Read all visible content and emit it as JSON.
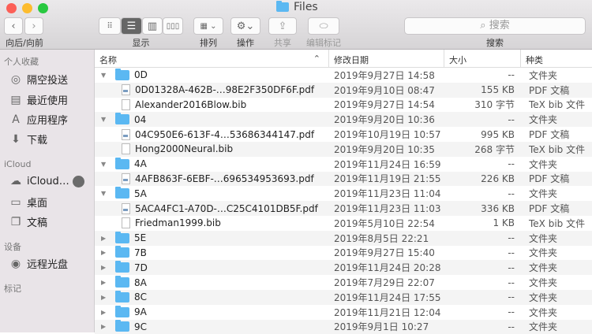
{
  "window": {
    "title": "Files"
  },
  "toolbar": {
    "nav_label": "向后/向前",
    "view_label": "显示",
    "arrange_label": "排列",
    "action_label": "操作",
    "share_label": "共享",
    "tags_label": "编辑标记",
    "search_placeholder": "搜索",
    "search_label": "搜索"
  },
  "sidebar": {
    "favorites_header": "个人收藏",
    "favorites": [
      {
        "label": "隔空投送",
        "icon": "airdrop-icon"
      },
      {
        "label": "最近使用",
        "icon": "recents-icon"
      },
      {
        "label": "应用程序",
        "icon": "applications-icon"
      },
      {
        "label": "下载",
        "icon": "downloads-icon"
      }
    ],
    "icloud_header": "iCloud",
    "icloud": [
      {
        "label": "iCloud…",
        "icon": "cloud-icon"
      },
      {
        "label": "桌面",
        "icon": "desktop-icon"
      },
      {
        "label": "文稿",
        "icon": "documents-icon"
      }
    ],
    "devices_header": "设备",
    "devices": [
      {
        "label": "远程光盘",
        "icon": "disc-icon"
      }
    ],
    "tags_header": "标记"
  },
  "columns": {
    "name": "名称",
    "date": "修改日期",
    "size": "大小",
    "kind": "种类"
  },
  "rows": [
    {
      "type": "folder",
      "open": true,
      "name": "0D",
      "date": "2019年9月27日 14:58",
      "size": "--",
      "kind": "文件夹"
    },
    {
      "type": "pdf",
      "name": "0D01328A-462B-…98E2F350DF6F.pdf",
      "date": "2019年9月10日 08:47",
      "size": "155 KB",
      "kind": "PDF 文稿"
    },
    {
      "type": "bib",
      "name": "Alexander2016Blow.bib",
      "date": "2019年9月27日 14:54",
      "size": "310 字节",
      "kind": "TeX bib 文件"
    },
    {
      "type": "folder",
      "open": true,
      "name": "04",
      "date": "2019年9月20日 10:36",
      "size": "--",
      "kind": "文件夹"
    },
    {
      "type": "pdf",
      "name": "04C950E6-613F-4…53686344147.pdf",
      "date": "2019年10月19日 10:57",
      "size": "995 KB",
      "kind": "PDF 文稿"
    },
    {
      "type": "bib",
      "name": "Hong2000Neural.bib",
      "date": "2019年9月20日 10:35",
      "size": "268 字节",
      "kind": "TeX bib 文件"
    },
    {
      "type": "folder",
      "open": true,
      "name": "4A",
      "date": "2019年11月24日 16:59",
      "size": "--",
      "kind": "文件夹"
    },
    {
      "type": "pdf",
      "name": "4AFB863F-6EBF-…696534953693.pdf",
      "date": "2019年11月19日 21:55",
      "size": "226 KB",
      "kind": "PDF 文稿"
    },
    {
      "type": "folder",
      "open": true,
      "name": "5A",
      "date": "2019年11月23日 11:04",
      "size": "--",
      "kind": "文件夹"
    },
    {
      "type": "pdf",
      "name": "5ACA4FC1-A70D-…C25C4101DB5F.pdf",
      "date": "2019年11月23日 11:03",
      "size": "336 KB",
      "kind": "PDF 文稿"
    },
    {
      "type": "bib",
      "name": "Friedman1999.bib",
      "date": "2019年5月10日 22:54",
      "size": "1 KB",
      "kind": "TeX bib 文件"
    },
    {
      "type": "folder",
      "open": false,
      "name": "5E",
      "date": "2019年8月5日 22:21",
      "size": "--",
      "kind": "文件夹"
    },
    {
      "type": "folder",
      "open": false,
      "name": "7B",
      "date": "2019年9月27日 15:40",
      "size": "--",
      "kind": "文件夹"
    },
    {
      "type": "folder",
      "open": false,
      "name": "7D",
      "date": "2019年11月24日 20:28",
      "size": "--",
      "kind": "文件夹"
    },
    {
      "type": "folder",
      "open": false,
      "name": "8A",
      "date": "2019年7月29日 22:07",
      "size": "--",
      "kind": "文件夹"
    },
    {
      "type": "folder",
      "open": false,
      "name": "8C",
      "date": "2019年11月24日 17:55",
      "size": "--",
      "kind": "文件夹"
    },
    {
      "type": "folder",
      "open": false,
      "name": "9A",
      "date": "2019年11月21日 12:04",
      "size": "--",
      "kind": "文件夹"
    },
    {
      "type": "folder",
      "open": false,
      "name": "9C",
      "date": "2019年9月1日 10:27",
      "size": "--",
      "kind": "文件夹"
    }
  ]
}
